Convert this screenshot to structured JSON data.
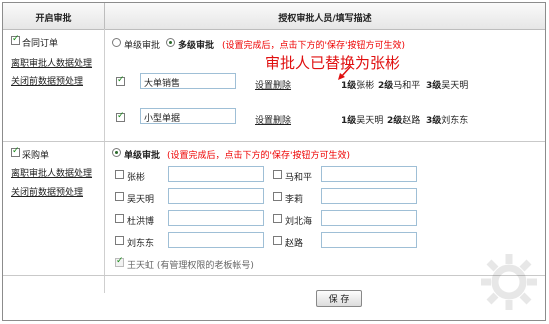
{
  "header": {
    "left_title": "开启审批",
    "right_title": "授权审批人员/填写描述"
  },
  "order_section": {
    "checkbox_label": "合同订单",
    "link_departed": "离职审批人数据处理",
    "link_close": "关闭前数据预处理",
    "radio_single": "单级审批",
    "radio_multi": "多级审批",
    "note": "(设置完成后，点击下方的'保存'按钮方可生效)",
    "annotation": "审批人已替换为张彬",
    "rows": [
      {
        "name": "大单销售",
        "setting": "设置",
        "delete": "删除",
        "levels": [
          {
            "lvl": "1级",
            "person": "张彬"
          },
          {
            "lvl": "2级",
            "person": "马和平"
          },
          {
            "lvl": "3级",
            "person": "吴天明"
          }
        ]
      },
      {
        "name": "小型单据",
        "setting": "设置",
        "delete": "删除",
        "levels": [
          {
            "lvl": "1级",
            "person": "吴天明"
          },
          {
            "lvl": "2级",
            "person": "赵路"
          },
          {
            "lvl": "3级",
            "person": "刘东东"
          }
        ]
      }
    ]
  },
  "purchase_section": {
    "checkbox_label": "采购单",
    "link_departed": "离职审批人数据处理",
    "link_close": "关闭前数据预处理",
    "radio_single": "单级审批",
    "note": "(设置完成后，点击下方的'保存'按钮方可生效)",
    "people_left": [
      "张彬",
      "吴天明",
      "杜洪博",
      "刘东东"
    ],
    "people_right": [
      "马和平",
      "李莉",
      "刘北海",
      "赵路"
    ],
    "admin_label": "王天虹 (有管理权限的老板帐号)"
  },
  "save_label": "保 存",
  "colors": {
    "accent_red": "#e00000",
    "input_border": "#9fbfd6"
  }
}
